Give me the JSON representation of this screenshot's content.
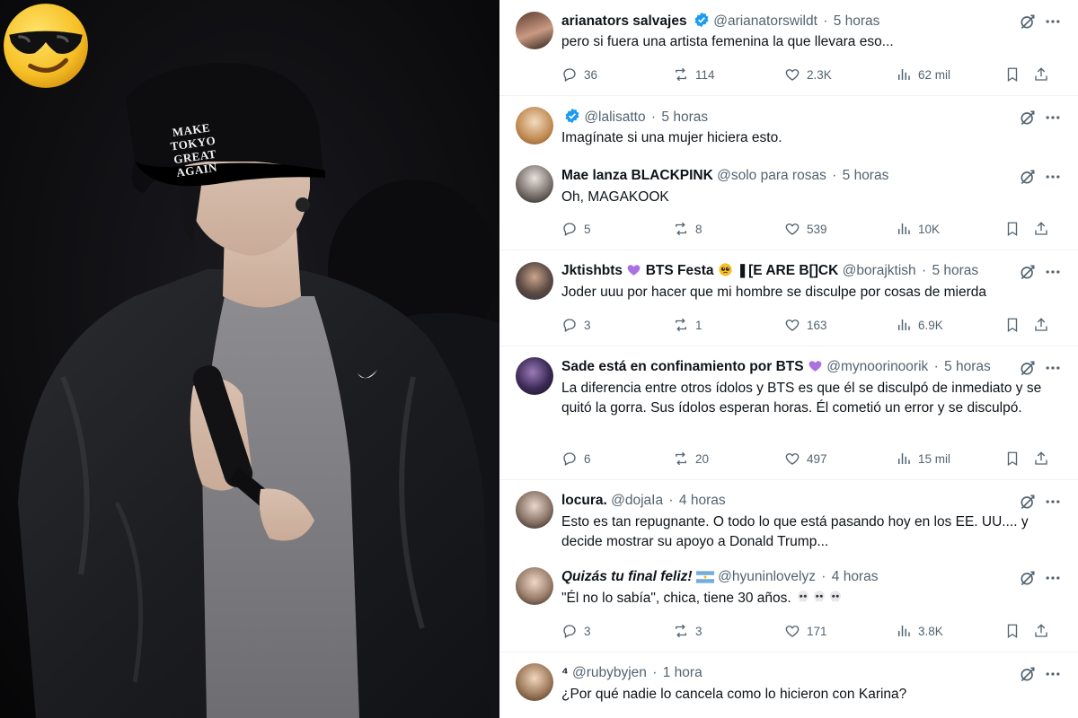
{
  "photo": {
    "cap_text": "MAKE TOKYO GREAT AGAIN",
    "emoji_icon": "smiling-face-with-sunglasses-icon"
  },
  "colors": {
    "verified": "#1d9bf0",
    "text": "#0f1419",
    "muted": "#536471",
    "divider": "#eff3f4"
  },
  "replies": [
    {
      "name": "arianators salvajes",
      "verified": true,
      "handle": "@arianatorswildt",
      "time": "5 horas",
      "text": "pero si fuera una artista femenina la que llevara eso...",
      "stats": {
        "replies": "36",
        "reposts": "114",
        "likes": "2.3K",
        "views": "62 mil"
      }
    },
    {
      "name": "",
      "verified": true,
      "handle": "@lalisatto",
      "time": "5 horas",
      "text": "Imagínate si una mujer hiciera esto."
    },
    {
      "name": "Mae lanza BLACKPINK",
      "handle": "@solo para rosas",
      "time": "5 horas",
      "text": "Oh, MAGAKOOK",
      "stats": {
        "replies": "5",
        "reposts": "8",
        "likes": "539",
        "views": "10K"
      }
    },
    {
      "name": "Jktishbts",
      "name_mid": "BTS Festa",
      "name_tail": "❚[E ARE B[]CK",
      "handle": "@borajktish",
      "time": "5 horas",
      "text": "Joder uuu por hacer que mi hombre se disculpe por cosas de mierda",
      "stats": {
        "replies": "3",
        "reposts": "1",
        "likes": "163",
        "views": "6.9K"
      }
    },
    {
      "name": "Sade está en confinamiento por BTS",
      "handle": "@mynoorinoorik",
      "time": "5 horas",
      "text": "La diferencia entre otros ídolos y BTS es que él se disculpó de inmediato y se quitó la gorra. Sus ídolos esperan horas. Él cometió un error y se disculpó.",
      "stats": {
        "replies": "6",
        "reposts": "20",
        "likes": "497",
        "views": "15 mil"
      }
    },
    {
      "name": "locura.",
      "handle": "@dojaIa",
      "time": "4 horas",
      "text": "Esto es tan repugnante. O todo lo que está pasando hoy en los EE. UU.... y decide mostrar su apoyo a Donald Trump..."
    },
    {
      "name": "Quizás tu final feliz!",
      "handle": "@hyuninlovelyz",
      "time": "4 horas",
      "text": "\"Él no lo sabía\", chica, tiene 30 años.",
      "stats": {
        "replies": "3",
        "reposts": "3",
        "likes": "171",
        "views": "3.8K"
      }
    },
    {
      "name": "⁴",
      "handle": "@rubybyjen",
      "time": "1 hora",
      "text": "¿Por qué nadie lo cancela como lo hicieron con Karina?"
    }
  ]
}
